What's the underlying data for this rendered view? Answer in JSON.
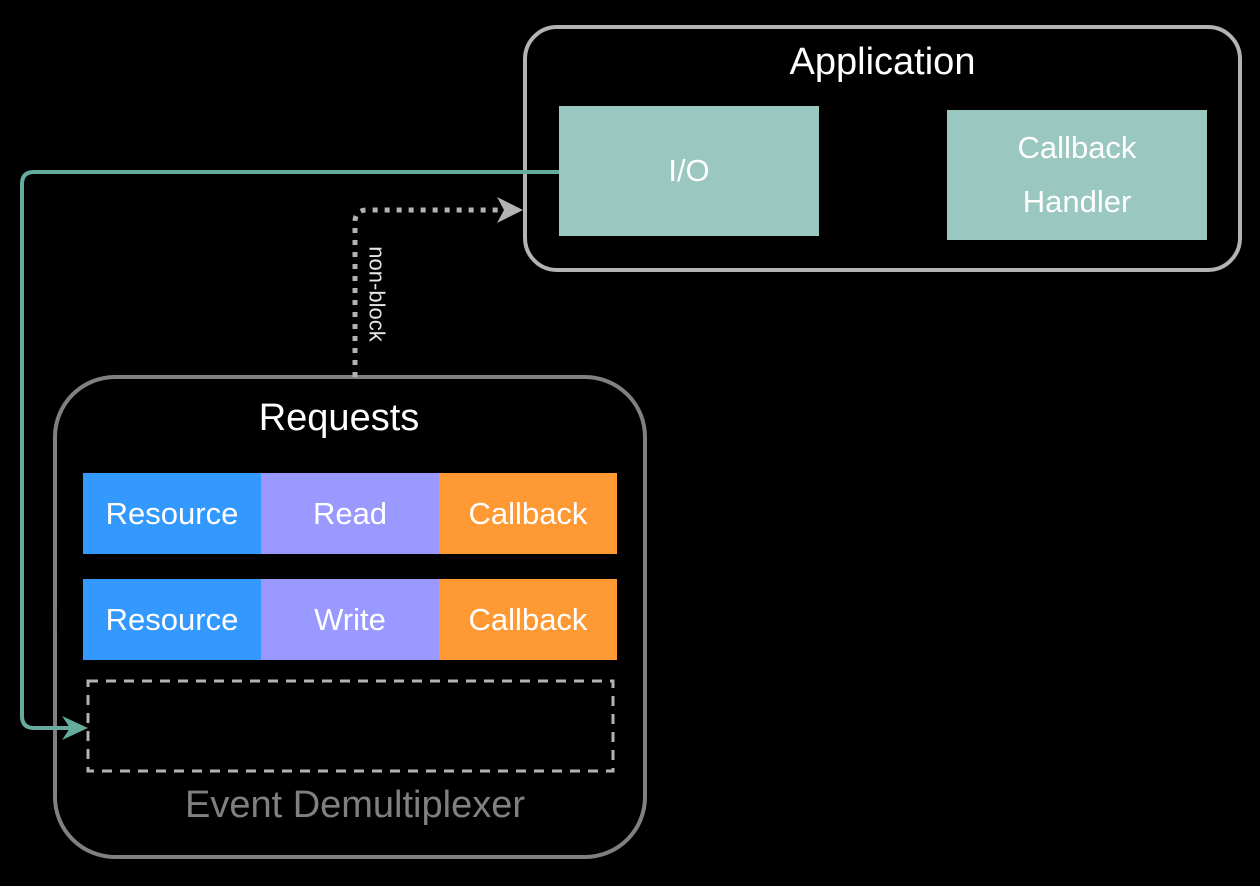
{
  "application": {
    "title": "Application",
    "io_label": "I/O",
    "callback_handler_label": "Callback Handler"
  },
  "edge_label": "non-block",
  "requests": {
    "title": "Requests",
    "rows": [
      {
        "resource": "Resource",
        "operation": "Read",
        "callback": "Callback"
      },
      {
        "resource": "Resource",
        "operation": "Write",
        "callback": "Callback"
      }
    ],
    "footer": "Event Demultiplexer"
  },
  "colors": {
    "resource": "#3399ff",
    "operation": "#9999ff",
    "callback": "#ff9933",
    "app_box": "#9ac7bf",
    "teal_edge": "#67ab9f",
    "outline_light": "#b3b3b3",
    "outline_dark": "#808080"
  }
}
